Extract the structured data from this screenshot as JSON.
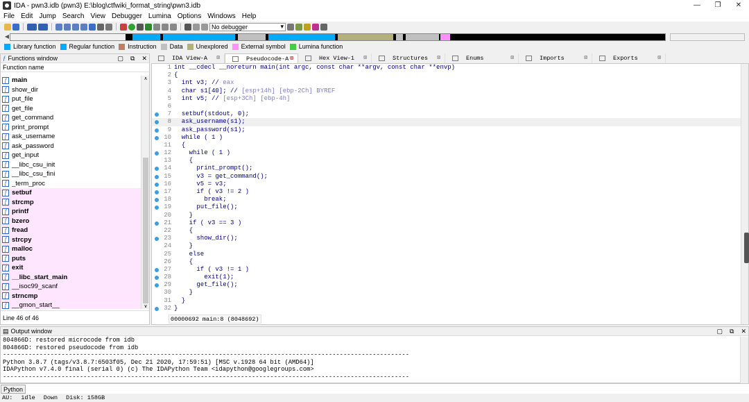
{
  "window": {
    "title": "IDA - pwn3.idb (pwn3) E:\\blog\\ctfwiki_format_string\\pwn3.idb",
    "minimize": "—",
    "maximize": "❐",
    "close": "✕"
  },
  "menu": [
    "File",
    "Edit",
    "Jump",
    "Search",
    "View",
    "Debugger",
    "Lumina",
    "Options",
    "Windows",
    "Help"
  ],
  "toolbar": {
    "debugger_select": "No debugger"
  },
  "legend": [
    {
      "label": "Library function",
      "color": "#00aaff"
    },
    {
      "label": "Regular function",
      "color": "#00aaff"
    },
    {
      "label": "Instruction",
      "color": "#c08060"
    },
    {
      "label": "Data",
      "color": "#c0c0c0"
    },
    {
      "label": "Unexplored",
      "color": "#b4b07c"
    },
    {
      "label": "External symbol",
      "color": "#ff90ff"
    },
    {
      "label": "Lumina function",
      "color": "#44cc44"
    }
  ],
  "functions_window": {
    "title": "Functions window",
    "column": "Function name",
    "footer": "Line 46 of 46",
    "items": [
      {
        "name": "main",
        "bold": true,
        "lib": false
      },
      {
        "name": "show_dir",
        "bold": false,
        "lib": false
      },
      {
        "name": "put_file",
        "bold": false,
        "lib": false
      },
      {
        "name": "get_file",
        "bold": false,
        "lib": false
      },
      {
        "name": "get_command",
        "bold": false,
        "lib": false
      },
      {
        "name": "print_prompt",
        "bold": false,
        "lib": false
      },
      {
        "name": "ask_username",
        "bold": false,
        "lib": false
      },
      {
        "name": "ask_password",
        "bold": false,
        "lib": false
      },
      {
        "name": "get_input",
        "bold": false,
        "lib": false
      },
      {
        "name": "__libc_csu_init",
        "bold": false,
        "lib": false
      },
      {
        "name": "__libc_csu_fini",
        "bold": false,
        "lib": false
      },
      {
        "name": "_term_proc",
        "bold": false,
        "lib": false
      },
      {
        "name": "setbuf",
        "bold": true,
        "lib": true
      },
      {
        "name": "strcmp",
        "bold": true,
        "lib": true
      },
      {
        "name": "printf",
        "bold": true,
        "lib": true
      },
      {
        "name": "bzero",
        "bold": true,
        "lib": true
      },
      {
        "name": "fread",
        "bold": true,
        "lib": true
      },
      {
        "name": "strcpy",
        "bold": true,
        "lib": true
      },
      {
        "name": "malloc",
        "bold": true,
        "lib": true
      },
      {
        "name": "puts",
        "bold": true,
        "lib": true
      },
      {
        "name": "exit",
        "bold": true,
        "lib": true
      },
      {
        "name": "__libc_start_main",
        "bold": true,
        "lib": true
      },
      {
        "name": "__isoc99_scanf",
        "bold": false,
        "lib": true
      },
      {
        "name": "strncmp",
        "bold": true,
        "lib": true
      },
      {
        "name": "__gmon_start__",
        "bold": false,
        "lib": true
      }
    ]
  },
  "tabs": [
    {
      "label": "IDA View-A",
      "active": false
    },
    {
      "label": "Pseudocode-A",
      "active": true
    },
    {
      "label": "Hex View-1",
      "active": false
    },
    {
      "label": "Structures",
      "active": false
    },
    {
      "label": "Enums",
      "active": false
    },
    {
      "label": "Imports",
      "active": false
    },
    {
      "label": "Exports",
      "active": false
    }
  ],
  "pseudocode": {
    "status": "00000692 main:8 (8048692)",
    "lines": [
      {
        "n": "1",
        "dot": false,
        "text": "int __cdecl __noreturn main(int argc, const char **argv, const char **envp)",
        "comment": ""
      },
      {
        "n": "2",
        "dot": false,
        "text": "{",
        "comment": ""
      },
      {
        "n": "3",
        "dot": false,
        "text": "  int v3; // ",
        "comment": "eax"
      },
      {
        "n": "4",
        "dot": false,
        "text": "  char s1[40]; // ",
        "comment": "[esp+14h] [ebp-2Ch] BYREF"
      },
      {
        "n": "5",
        "dot": false,
        "text": "  int v5; // ",
        "comment": "[esp+3Ch] [ebp-4h]"
      },
      {
        "n": "6",
        "dot": false,
        "text": "",
        "comment": ""
      },
      {
        "n": "7",
        "dot": true,
        "text": "  setbuf(stdout, 0);",
        "comment": ""
      },
      {
        "n": "8",
        "dot": true,
        "text": "  ask_username(s1);",
        "comment": ""
      },
      {
        "n": "9",
        "dot": true,
        "text": "  ask_password(s1);",
        "comment": ""
      },
      {
        "n": "10",
        "dot": true,
        "text": "  while ( 1 )",
        "comment": ""
      },
      {
        "n": "11",
        "dot": false,
        "text": "  {",
        "comment": ""
      },
      {
        "n": "12",
        "dot": true,
        "text": "    while ( 1 )",
        "comment": ""
      },
      {
        "n": "13",
        "dot": false,
        "text": "    {",
        "comment": ""
      },
      {
        "n": "14",
        "dot": true,
        "text": "      print_prompt();",
        "comment": ""
      },
      {
        "n": "15",
        "dot": true,
        "text": "      v3 = get_command();",
        "comment": ""
      },
      {
        "n": "16",
        "dot": true,
        "text": "      v5 = v3;",
        "comment": ""
      },
      {
        "n": "17",
        "dot": true,
        "text": "      if ( v3 != 2 )",
        "comment": ""
      },
      {
        "n": "18",
        "dot": true,
        "text": "        break;",
        "comment": ""
      },
      {
        "n": "19",
        "dot": true,
        "text": "      put_file();",
        "comment": ""
      },
      {
        "n": "20",
        "dot": false,
        "text": "    }",
        "comment": ""
      },
      {
        "n": "21",
        "dot": true,
        "text": "    if ( v3 == 3 )",
        "comment": ""
      },
      {
        "n": "22",
        "dot": false,
        "text": "    {",
        "comment": ""
      },
      {
        "n": "23",
        "dot": true,
        "text": "      show_dir();",
        "comment": ""
      },
      {
        "n": "24",
        "dot": false,
        "text": "    }",
        "comment": ""
      },
      {
        "n": "25",
        "dot": false,
        "text": "    else",
        "comment": ""
      },
      {
        "n": "26",
        "dot": false,
        "text": "    {",
        "comment": ""
      },
      {
        "n": "27",
        "dot": true,
        "text": "      if ( v3 != 1 )",
        "comment": ""
      },
      {
        "n": "28",
        "dot": true,
        "text": "        exit(1);",
        "comment": ""
      },
      {
        "n": "29",
        "dot": true,
        "text": "      get_file();",
        "comment": ""
      },
      {
        "n": "30",
        "dot": false,
        "text": "    }",
        "comment": ""
      },
      {
        "n": "31",
        "dot": false,
        "text": "  }",
        "comment": ""
      },
      {
        "n": "32",
        "dot": true,
        "text": "}",
        "comment": ""
      }
    ]
  },
  "output_window": {
    "title": "Output window",
    "lines": [
      "804866D: restored microcode from idb",
      "804866D: restored pseudocode from idb",
      "---------------------------------------------------------------------------------------------------------------",
      "Python 3.8.7 (tags/v3.8.7:6503f05, Dec 21 2020, 17:59:51) [MSC v.1928 64 bit (AMD64)]",
      "IDAPython v7.4.0 final (serial 0) (c) The IDAPython Team <idapython@googlegroups.com>",
      "---------------------------------------------------------------------------------------------------------------"
    ]
  },
  "python_input": {
    "label": "Python"
  },
  "statusbar": {
    "au": "AU:",
    "state": "idle",
    "direction": "Down",
    "disk": "Disk: 158GB"
  }
}
